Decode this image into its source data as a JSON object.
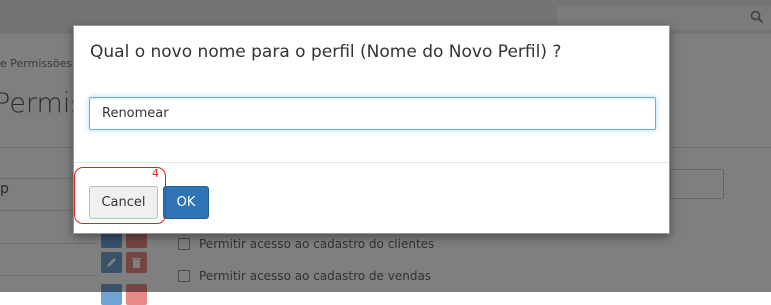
{
  "breadcrumb": {
    "text": "e Permissões"
  },
  "page": {
    "title": "Permiss"
  },
  "background": {
    "list_letter": "p",
    "permissions": [
      "Permitir acesso ao cadastro do clientes",
      "Permitir acesso ao cadastro de vendas"
    ]
  },
  "search": {
    "icon": "search-icon"
  },
  "modal": {
    "title": "Qual o novo nome para o perfil (Nome do Novo Perfil) ?",
    "input_value": "Renomear",
    "cancel_label": "Cancel",
    "ok_label": "OK"
  },
  "annotation": {
    "step": "4",
    "color": "#e02020"
  },
  "colors": {
    "primary": "#2f75b5",
    "focus": "#66afe9"
  }
}
